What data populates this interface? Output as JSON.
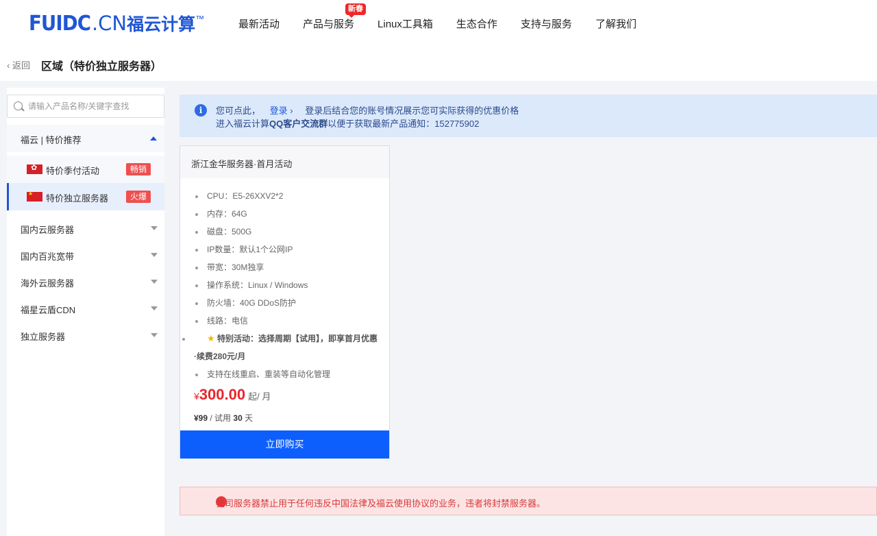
{
  "brand": {
    "logo_main": "FUIDC",
    "logo_cn": ".CN",
    "logo_name": "福云计算",
    "logo_tm": "™"
  },
  "nav": {
    "items": [
      {
        "label": "最新活动"
      },
      {
        "label": "产品与服务",
        "badge": "新春"
      },
      {
        "label": "Linux工具箱"
      },
      {
        "label": "生态合作"
      },
      {
        "label": "支持与服务"
      },
      {
        "label": "了解我们"
      }
    ]
  },
  "breadcrumb": {
    "back": "返回",
    "title": "区域（特价独立服务器）"
  },
  "sidebar": {
    "search_placeholder": "请输入产品名称/关键字查找",
    "group": "福云 | 特价推荐",
    "sub_items": [
      {
        "label": "特价季付活动",
        "tag": "畅销"
      },
      {
        "label": "特价独立服务器",
        "tag": "火爆"
      }
    ],
    "categories": [
      {
        "label": "国内云服务器"
      },
      {
        "label": "国内百兆宽带"
      },
      {
        "label": "海外云服务器"
      },
      {
        "label": "福星云盾CDN"
      },
      {
        "label": "独立服务器"
      }
    ]
  },
  "notice": {
    "line1_prefix": "您可点此，",
    "login": "登录 ›",
    "line1_suffix": "登录后结合您的账号情况展示您可实际获得的优惠价格",
    "line2_prefix": "进入福云计算",
    "line2_bold": "QQ客户交流群",
    "line2_suffix": "以便于获取最新产品通知：152775902"
  },
  "product": {
    "title": "浙江金华服务器·首月活动",
    "specs": [
      "CPU：E5-26XXV2*2",
      "内存：64G",
      "磁盘：500G",
      "IP数量：默认1个公网IP",
      "带宽：30M独享",
      "操作系统：Linux / Windows",
      "防火墙：40G DDoS防护",
      "线路：电信"
    ],
    "special": "特别活动：选择周期【试用】，即享首月优惠·续费280元/月",
    "extra": "支持在线重启、重装等自动化管理",
    "price_currency": "¥",
    "price": "300.00",
    "price_unit": "起/ 月",
    "trial_price": "¥99",
    "trial_text": "/ 试用",
    "trial_days": "30",
    "trial_days_unit": "天",
    "buy_label": "立即购买"
  },
  "warning": {
    "text": "我司服务器禁止用于任何违反中国法律及福云使用协议的业务，违者将封禁服务器。"
  }
}
